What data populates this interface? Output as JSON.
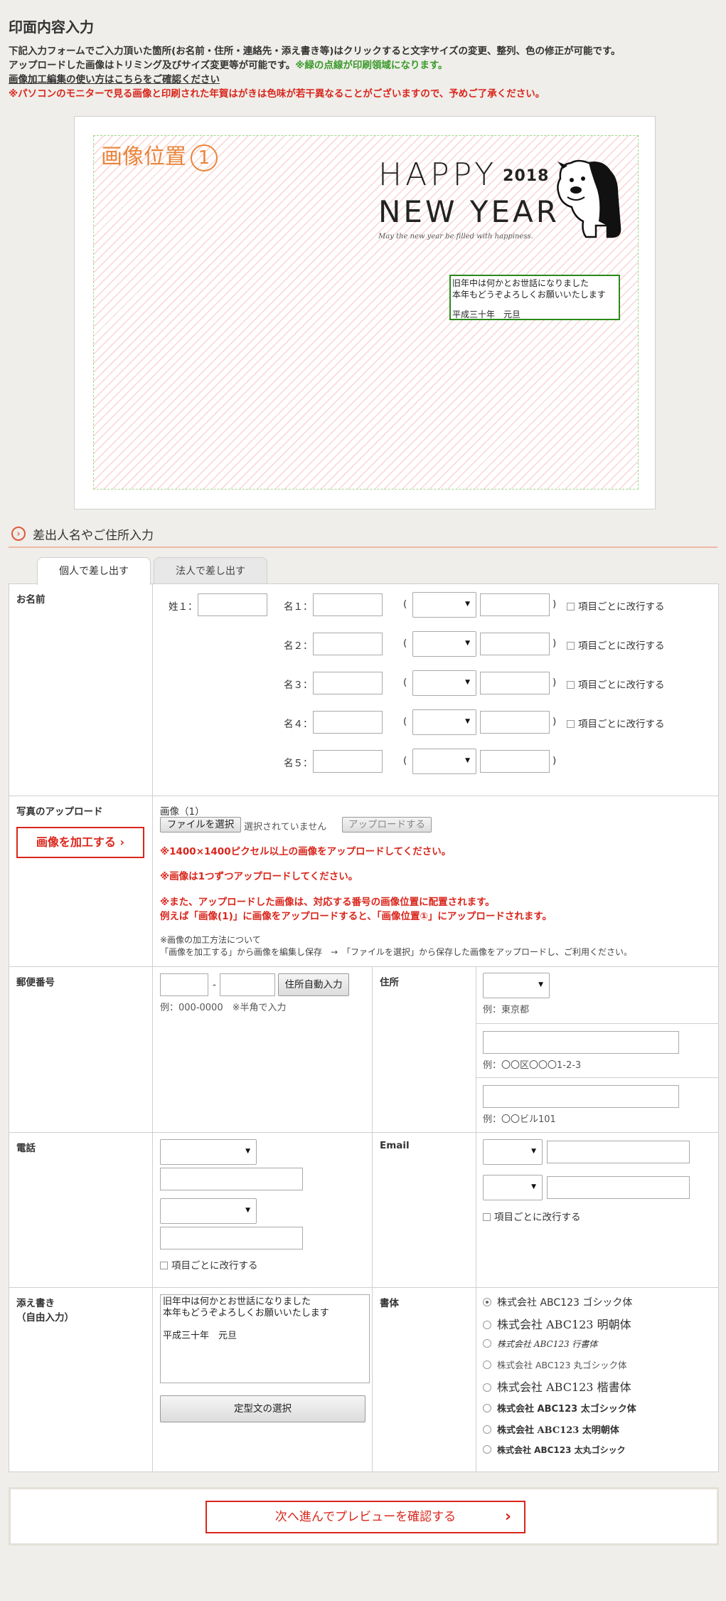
{
  "page_title": "印面内容入力",
  "intro": {
    "line1": "下記入力フォームでご入力頂いた箇所(お名前・住所・連絡先・添え書き等)はクリックすると文字サイズの変更、整列、色の修正が可能です。",
    "line2_a": "アップロードした画像はトリミング及びサイズ変更等が可能です。",
    "line2_b": "※緑の点線が印刷領域になります。",
    "line3_link": "画像加工編集の使い方はこちらをご確認ください",
    "line4_red": "※パソコンのモニターで見る画像と印刷された年賀はがきは色味が若干異なることがございますので、予めご了承ください。"
  },
  "preview": {
    "image_position_label": "画像位置",
    "image_position_num": "1",
    "hny_line1": "HAPPY",
    "hny_year": "2018",
    "hny_line2": "NEW YEAR",
    "hny_sub": "May the new year be filled with happiness.",
    "greeting_line1": "旧年中は何かとお世話になりました",
    "greeting_line2": "本年もどうぞよろしくお願いいたします",
    "greeting_line3": "平成三十年　元旦"
  },
  "section": {
    "title": "差出人名やご住所入力"
  },
  "tabs": [
    {
      "label": "個人で差し出す",
      "active": true
    },
    {
      "label": "法人で差し出す",
      "active": false
    }
  ],
  "name_row": {
    "label": "お名前",
    "surname": "姓１：",
    "given": [
      "名１：",
      "名２：",
      "名３：",
      "名４：",
      "名５："
    ],
    "paren_open": "(",
    "paren_close": ")",
    "linebreak_label": "項目ごとに改行する"
  },
  "photo_row": {
    "label": "写真のアップロード",
    "edit_button": "画像を加工する",
    "image_label": "画像（1）",
    "file_button": "ファイルを選択",
    "no_file": "選択されていません",
    "upload_button": "アップロードする",
    "note1": "※1400×1400ピクセル以上の画像をアップロードしてください。",
    "note2": "※画像は1つずつアップロードしてください。",
    "note3": "※また、アップロードした画像は、対応する番号の画像位置に配置されます。",
    "note4": "例えば「画像(1)」に画像をアップロードすると、「画像位置①」にアップロードされます。",
    "method1": "※画像の加工方法について",
    "method2": "「画像を加工する」から画像を編集し保存　→　「ファイルを選択」から保存した画像をアップロードし、ご利用ください。"
  },
  "postal_row": {
    "label": "郵便番号",
    "dash": "-",
    "auto_button": "住所自動入力",
    "example": "例：000-0000　※半角で入力"
  },
  "address_row": {
    "label": "住所",
    "example1": "例：東京都",
    "example2": "例：〇〇区〇〇〇1-2-3",
    "example3": "例：〇〇ビル101"
  },
  "phone_row": {
    "label": "電話",
    "linebreak_label": "項目ごとに改行する"
  },
  "email_row": {
    "label": "Email",
    "linebreak_label": "項目ごとに改行する"
  },
  "note_row": {
    "label1": "添え書き",
    "label2": "（自由入力）",
    "text": "旧年中は何かとお世話になりました\n本年もどうぞよろしくお願いいたします\n\n平成三十年　元旦",
    "template_button": "定型文の選択"
  },
  "font_row": {
    "label": "書体",
    "options": [
      "株式会社 ABC123 ゴシック体",
      "株式会社 ABC123 明朝体",
      "株式会社 ABC123 行書体",
      "株式会社 ABC123 丸ゴシック体",
      "株式会社 ABC123 楷書体",
      "株式会社 ABC123 太ゴシック体",
      "株式会社 ABC123 太明朝体",
      "株式会社 ABC123 太丸ゴシック"
    ],
    "selected_index": 0
  },
  "next_button": "次へ進んでプレビューを確認する",
  "colors": {
    "accent_red": "#d9261c",
    "green": "#3a9a2a",
    "orange": "#e9853a"
  }
}
